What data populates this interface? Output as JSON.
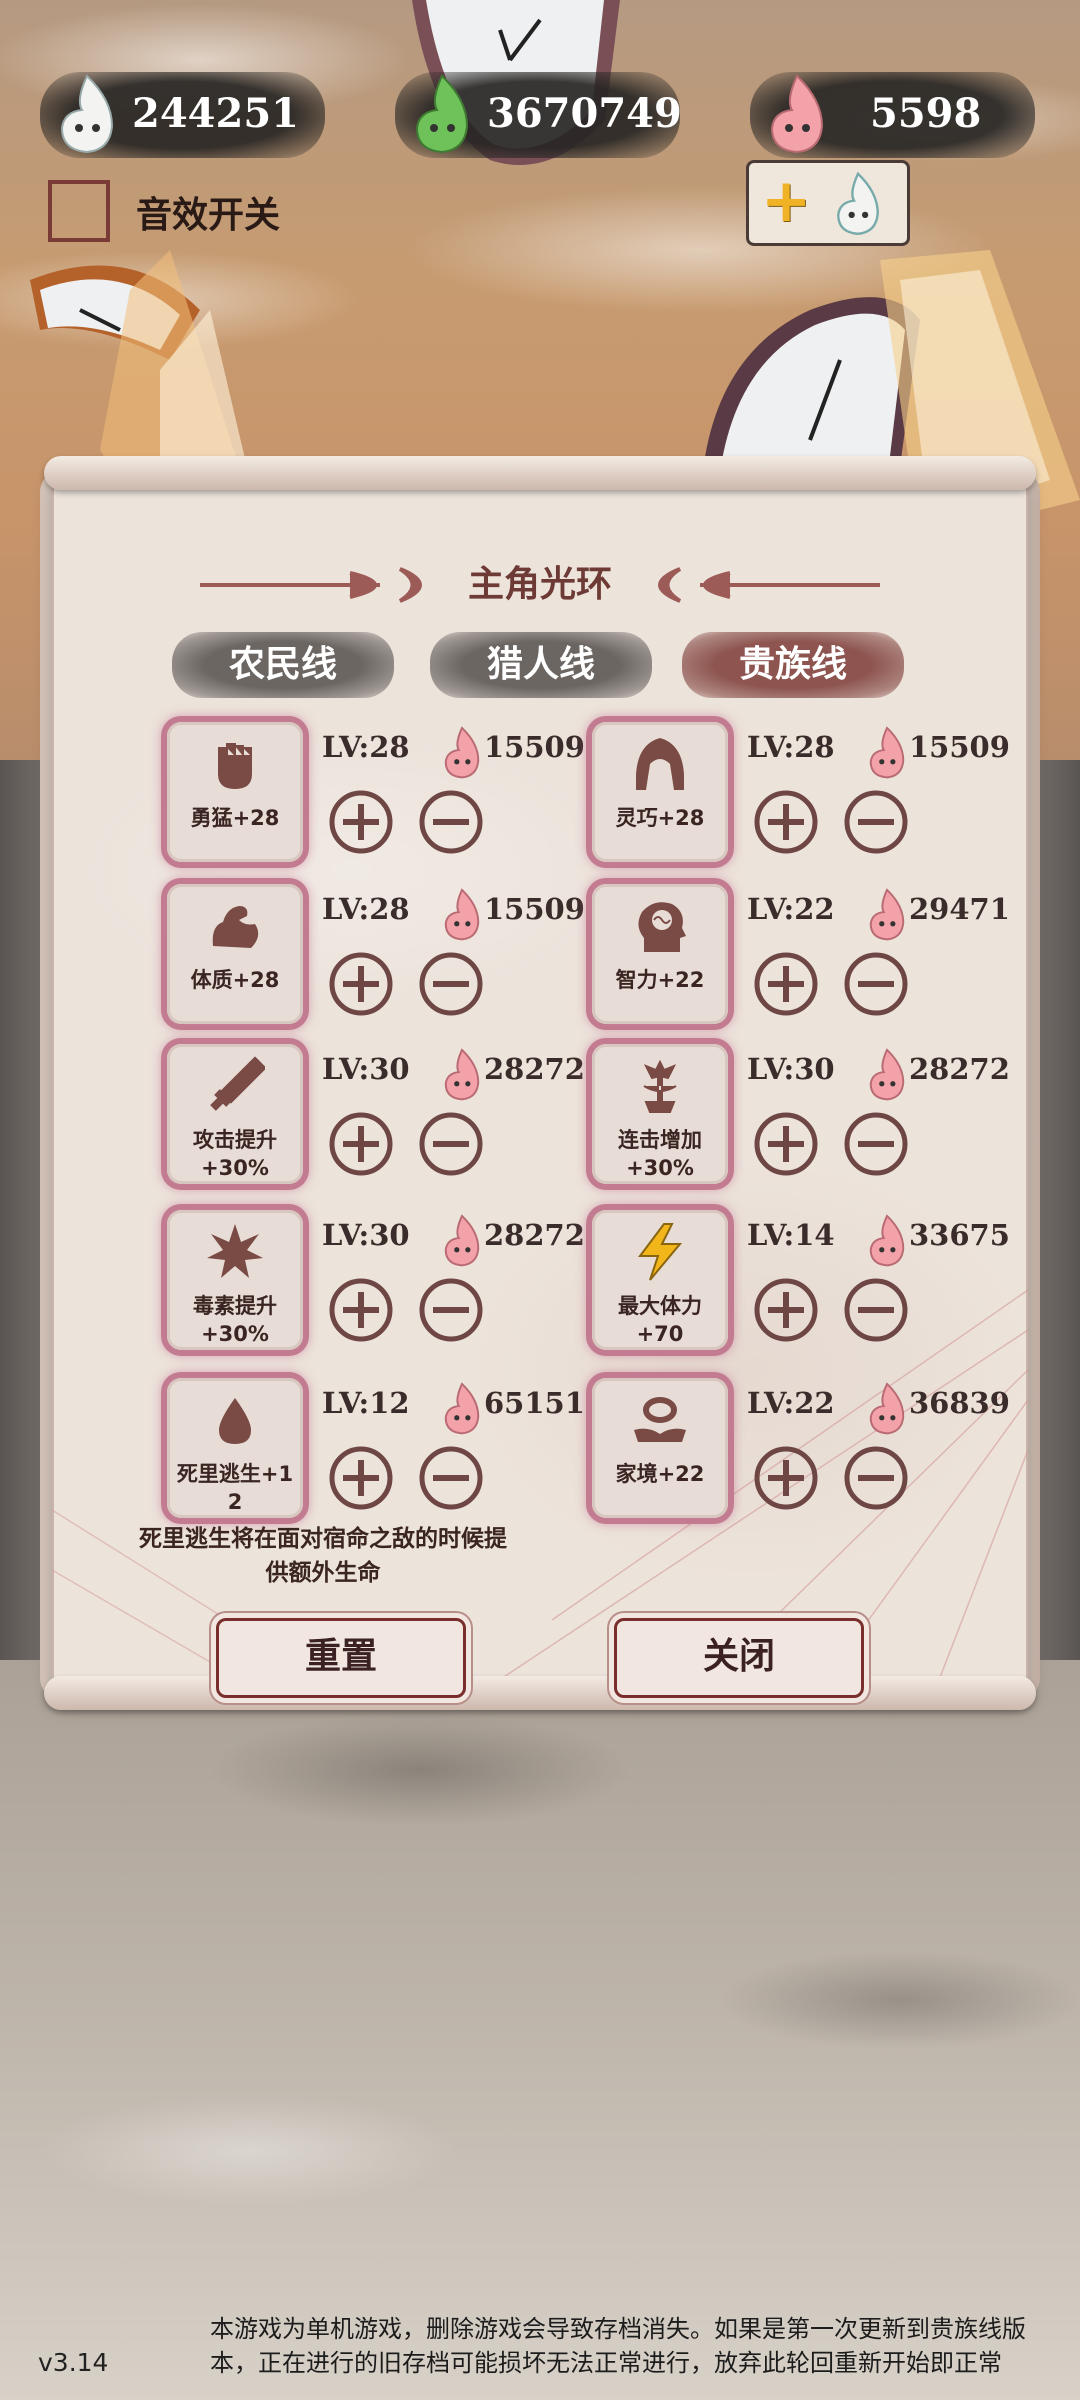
{
  "currencies": [
    {
      "name": "white-spirit",
      "amount": "244251",
      "color": "#f3f4f2"
    },
    {
      "name": "green-spirit",
      "amount": "3670749",
      "color": "#6fc25a"
    },
    {
      "name": "pink-spirit",
      "amount": "5598",
      "color": "#f2a2a8"
    }
  ],
  "settings": {
    "sound_toggle_label": "音效开关",
    "sound_enabled": false
  },
  "panel": {
    "title": "主角光环",
    "tabs": [
      {
        "label": "农民线",
        "active": false
      },
      {
        "label": "猎人线",
        "active": false
      },
      {
        "label": "贵族线",
        "active": true
      }
    ],
    "skills": [
      {
        "label": "勇猛+28",
        "level": "LV:28",
        "cost": "15509",
        "icon": "fist-icon"
      },
      {
        "label": "灵巧+28",
        "level": "LV:28",
        "cost": "15509",
        "icon": "hood-icon"
      },
      {
        "label": "体质+28",
        "level": "LV:28",
        "cost": "15509",
        "icon": "arm-muscle-icon"
      },
      {
        "label": "智力+22",
        "level": "LV:22",
        "cost": "29471",
        "icon": "brain-head-icon"
      },
      {
        "label": "攻击提升\n+30%",
        "level": "LV:30",
        "cost": "28272",
        "icon": "sword-icon"
      },
      {
        "label": "连击增加\n+30%",
        "level": "LV:30",
        "cost": "28272",
        "icon": "tree-hand-icon"
      },
      {
        "label": "毒素提升\n+30%",
        "level": "LV:30",
        "cost": "28272",
        "icon": "burst-icon"
      },
      {
        "label": "最大体力\n+70",
        "level": "LV:14",
        "cost": "33675",
        "icon": "lightning-icon"
      },
      {
        "label": "死里逃生+1\n2",
        "level": "LV:12",
        "cost": "65151",
        "icon": "drop-icon"
      },
      {
        "label": "家境+22",
        "level": "LV:22",
        "cost": "36839",
        "icon": "coin-hand-icon"
      }
    ],
    "description": "死里逃生将在面对宿命之敌的时候提供额外生命",
    "reset_label": "重置",
    "close_label": "关闭"
  },
  "footer": {
    "version": "v3.14",
    "notice_line1": "本游戏为单机游戏，删除游戏会导致存档消失。如果是第一次更新到贵族线版",
    "notice_line2": "本，正在进行的旧存档可能损坏无法正常进行，放弃此轮回重新开始即正常"
  },
  "colors": {
    "accent": "#8e5550",
    "card_glow": "#c37b91",
    "text_dark": "#3a2c2a"
  }
}
